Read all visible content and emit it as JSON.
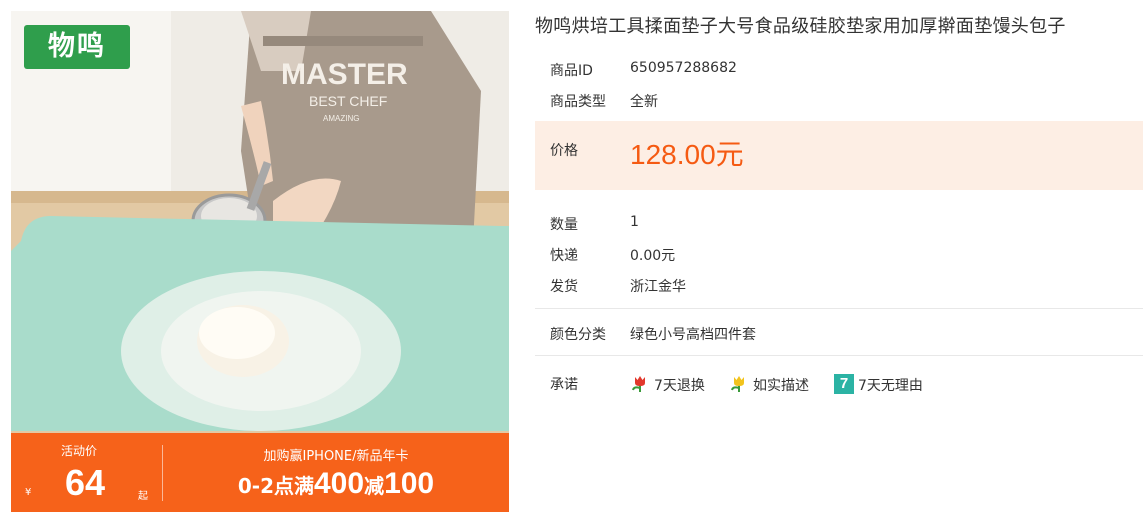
{
  "image": {
    "brand_logo": "物鸣",
    "apron_text_main": "MASTER",
    "apron_text_sub": "BEST CHEF",
    "apron_text_small": "AMAZING",
    "promo": {
      "label": "活动价",
      "currency": "¥",
      "price": "64",
      "suffix": "起",
      "headline": "加购赢IPHONE/新品年卡",
      "deal_prefix": "0-2点满",
      "deal_amount_1": "400",
      "deal_mid": "减",
      "deal_amount_2": "100",
      "background_color": "#f6621a"
    }
  },
  "product": {
    "title": "物鸣烘培工具揉面垫子大号食品级硅胶垫家用加厚擀面垫馒头包子",
    "id_label": "商品ID",
    "id_value": "650957288682",
    "type_label": "商品类型",
    "type_value": "全新",
    "price_label": "价格",
    "price_value": "128.00元",
    "price_color": "#f55a12",
    "quantity_label": "数量",
    "quantity_value": "1",
    "shipping_label": "快递",
    "shipping_value": "0.00元",
    "origin_label": "发货",
    "origin_value": "浙江金华",
    "color_label": "颜色分类",
    "color_value": "绿色小号高档四件套",
    "promise_label": "承诺",
    "promises": [
      {
        "icon": "tulip-icon-red",
        "text": "7天退换"
      },
      {
        "icon": "tulip-icon-yellow",
        "text": "如实描述"
      },
      {
        "icon": "seven-day-icon",
        "icon_text": "7",
        "text": "7天无理由"
      }
    ]
  }
}
